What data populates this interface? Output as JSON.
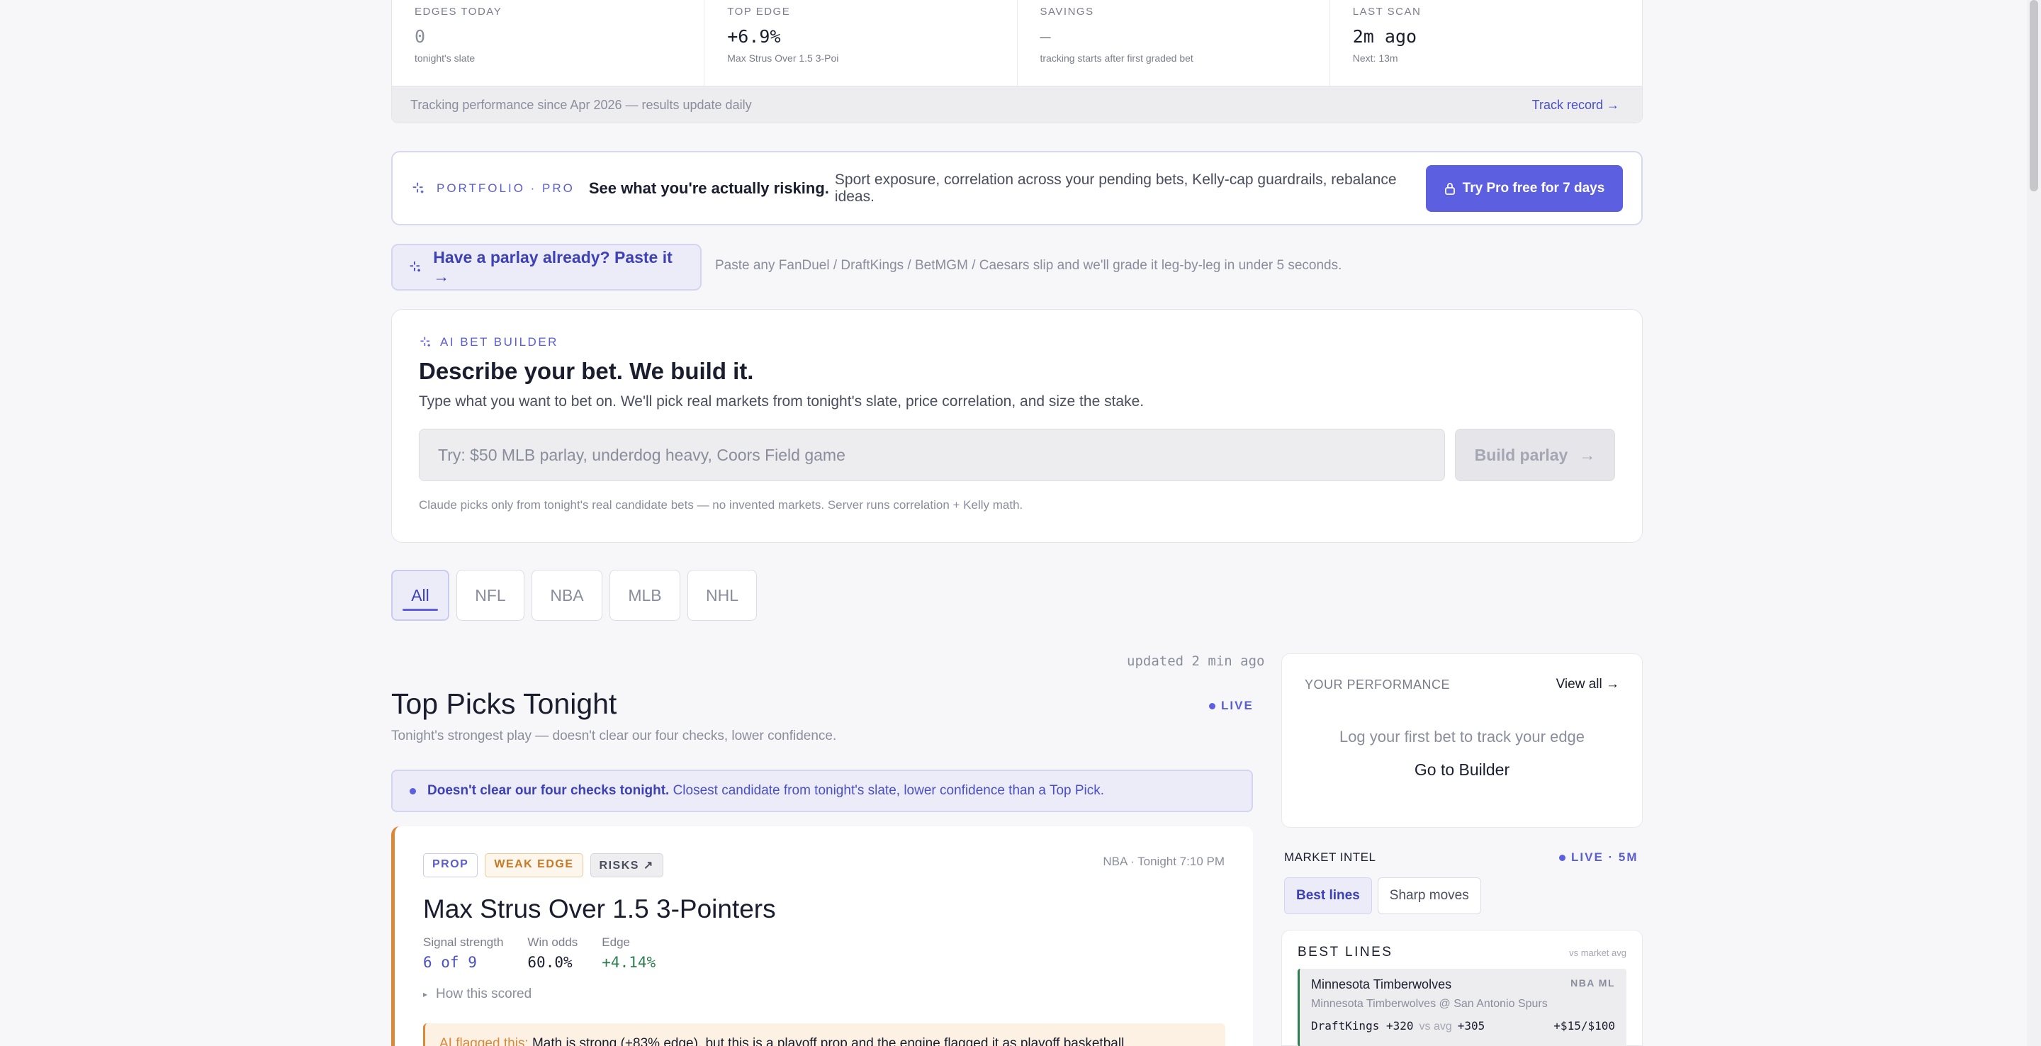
{
  "stats": [
    {
      "label": "EDGES TODAY",
      "value": "0",
      "sub": "tonight's slate",
      "dim": true
    },
    {
      "label": "TOP EDGE",
      "value": "+6.9%",
      "sub": "Max Strus Over 1.5 3-Poi",
      "dim": false
    },
    {
      "label": "SAVINGS",
      "value": "—",
      "sub": "tracking starts after first graded bet",
      "dim": true
    },
    {
      "label": "LAST SCAN",
      "value": "2m ago",
      "sub": "Next: 13m",
      "dim": false
    }
  ],
  "stats_footer": {
    "text": "Tracking performance since Apr 2026 — results update daily",
    "link": "Track record →"
  },
  "portfolio": {
    "tag": "PORTFOLIO · PRO",
    "headline": "See what you're actually risking.",
    "description": "Sport exposure, correlation across your pending bets, Kelly-cap guardrails, rebalance ideas.",
    "cta": "Try Pro free for 7 days"
  },
  "paste": {
    "button": "Have a parlay already? Paste it →",
    "hint": "Paste any FanDuel / DraftKings / BetMGM / Caesars slip and we'll grade it leg-by-leg in under 5 seconds."
  },
  "builder": {
    "tag": "AI BET BUILDER",
    "title": "Describe your bet. We build it.",
    "subtitle": "Type what you want to bet on. We'll pick real markets from tonight's slate, price correlation, and size the stake.",
    "placeholder": "Try: $50 MLB parlay, underdog heavy, Coors Field game",
    "button": "Build parlay",
    "note": "Claude picks only from tonight's real candidate bets — no invented markets. Server runs correlation + Kelly math."
  },
  "leagues": [
    "All",
    "NFL",
    "NBA",
    "MLB",
    "NHL"
  ],
  "picks": {
    "updated": "updated 2 min ago",
    "title": "Top Picks Tonight",
    "live": "LIVE",
    "subtitle": "Tonight's strongest play — doesn't clear our four checks, lower confidence.",
    "notice_bold": "Doesn't clear our four checks tonight.",
    "notice_text": "Closest candidate from tonight's slate, lower confidence than a Top Pick."
  },
  "pick": {
    "badges": [
      "PROP",
      "WEAK EDGE",
      "RISKS ↗"
    ],
    "game": "NBA · Tonight 7:10 PM",
    "title": "Max Strus Over 1.5 3-Pointers",
    "metrics": [
      {
        "label": "Signal strength",
        "value": "6 of 9"
      },
      {
        "label": "Win odds",
        "value": "60.0%"
      },
      {
        "label": "Edge",
        "value": "+4.14%"
      }
    ],
    "how": "How this scored",
    "flag_label": "AI flagged this:",
    "flag_text": "Math is strong (+83% edge), but this is a playoff prop and the engine flagged it as playoff basketball"
  },
  "performance": {
    "label": "YOUR PERFORMANCE",
    "view_all": "View all",
    "empty": "Log your first bet to track your edge",
    "link": "Go to Builder"
  },
  "intel": {
    "label": "MARKET INTEL",
    "live": "LIVE · 5M",
    "tabs": [
      "Best lines",
      "Sharp moves"
    ]
  },
  "best_lines": {
    "title": "BEST LINES",
    "vs": "vs market avg",
    "item": {
      "team": "Minnesota Timberwolves",
      "market": "NBA ML",
      "matchup": "Minnesota Timberwolves @ San Antonio Spurs",
      "book_odds": "DraftKings +320",
      "vs_label": "vs avg",
      "avg": "+305",
      "value": "+$15/$100"
    }
  }
}
